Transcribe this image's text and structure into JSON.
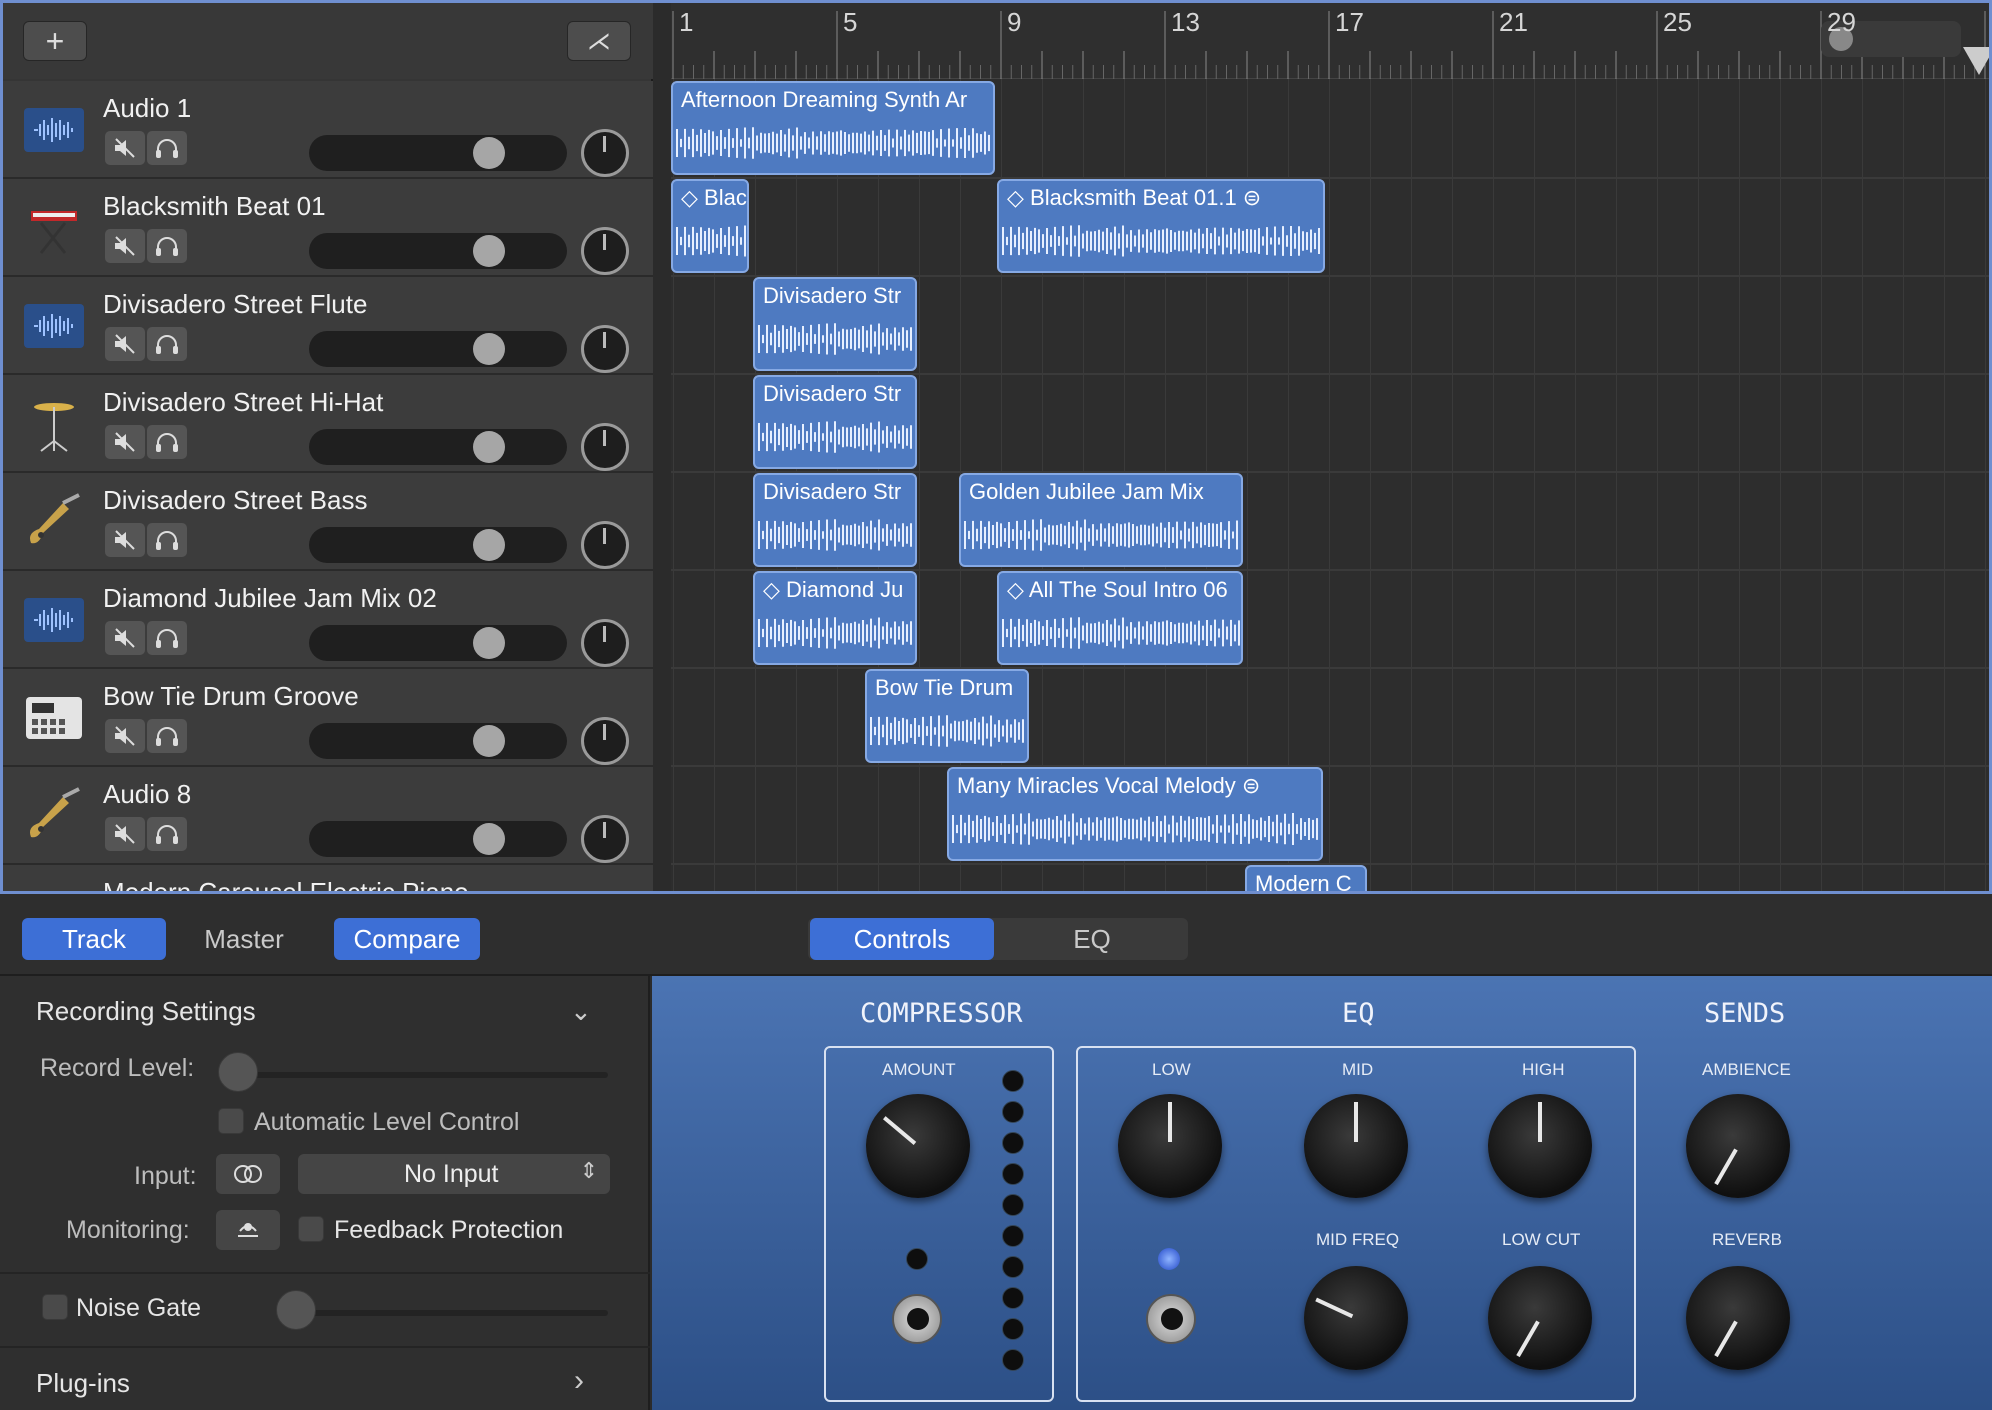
{
  "toolbar": {
    "add_label": "+",
    "split_label": "⋌"
  },
  "ruler": {
    "marks": [
      "1",
      "5",
      "9",
      "13",
      "17",
      "21",
      "25",
      "29"
    ]
  },
  "tracks": [
    {
      "name": "Audio 1",
      "icon": "waveform-icon"
    },
    {
      "name": "Blacksmith Beat 01",
      "icon": "keyboard-stand-icon"
    },
    {
      "name": "Divisadero Street Flute",
      "icon": "waveform-icon"
    },
    {
      "name": "Divisadero Street Hi-Hat",
      "icon": "hihat-icon"
    },
    {
      "name": "Divisadero Street Bass",
      "icon": "bass-guitar-icon"
    },
    {
      "name": "Diamond Jubilee Jam Mix 02",
      "icon": "waveform-icon"
    },
    {
      "name": "Bow Tie Drum Groove",
      "icon": "drum-machine-icon"
    },
    {
      "name": "Audio 8",
      "icon": "bass-guitar-icon"
    },
    {
      "name": "Modern Carousel Electric Piano",
      "icon": "piano-icon"
    }
  ],
  "regions": [
    {
      "label": "Afternoon Dreaming Synth Ar",
      "track": 0
    },
    {
      "label": "◇ Blac",
      "track": 1
    },
    {
      "label": "◇ Blacksmith Beat 01.1  ⊜",
      "track": 1
    },
    {
      "label": "Divisadero Str",
      "track": 2
    },
    {
      "label": "Divisadero Str",
      "track": 3
    },
    {
      "label": "Divisadero Str",
      "track": 4
    },
    {
      "label": "Golden Jubilee Jam Mix",
      "track": 4
    },
    {
      "label": "◇ Diamond Ju",
      "track": 5
    },
    {
      "label": "◇ All The Soul Intro 06",
      "track": 5
    },
    {
      "label": "Bow Tie Drum",
      "track": 6
    },
    {
      "label": "Many Miracles Vocal Melody  ⊜",
      "track": 7
    },
    {
      "label": "Modern C",
      "track": 8
    }
  ],
  "bottom_toolbar": {
    "track_tab": "Track",
    "master_tab": "Master",
    "compare_button": "Compare",
    "controls_tab": "Controls",
    "eq_tab": "EQ"
  },
  "recording": {
    "section_title": "Recording Settings",
    "record_level_label": "Record Level:",
    "alc_label": "Automatic Level Control",
    "input_label": "Input:",
    "input_value": "No Input",
    "monitoring_label": "Monitoring:",
    "feedback_label": "Feedback Protection",
    "noise_gate_label": "Noise Gate",
    "plugins_label": "Plug-ins"
  },
  "plugin": {
    "compressor_title": "COMPRESSOR",
    "eq_title": "EQ",
    "sends_title": "SENDS",
    "amount_label": "AMOUNT",
    "low_label": "LOW",
    "mid_label": "MID",
    "high_label": "HIGH",
    "midfreq_label": "MID FREQ",
    "lowcut_label": "LOW CUT",
    "ambience_label": "AMBIENCE",
    "reverb_label": "REVERB"
  },
  "colors": {
    "accent": "#3d6fd6",
    "region": "#4e7ac1",
    "plugin_bg": "#3b62a0"
  }
}
